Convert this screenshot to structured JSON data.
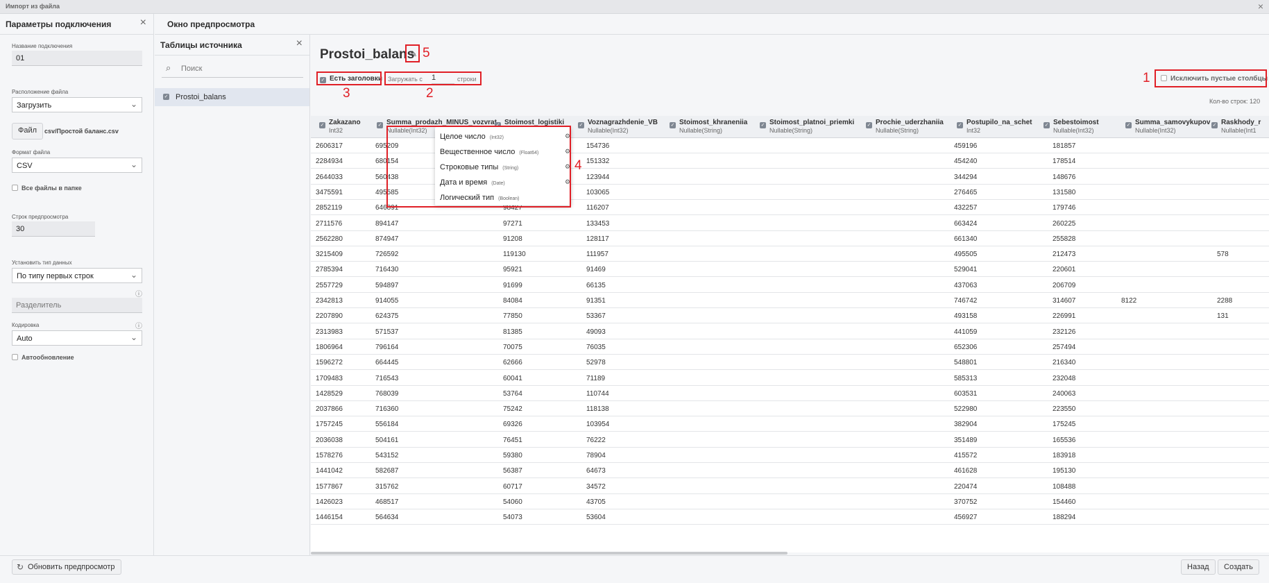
{
  "window": {
    "title": "Импорт из файла",
    "close": "×"
  },
  "left_panel": {
    "title": "Параметры подключения",
    "conn_name_label": "Название подключения",
    "conn_name_value": "01",
    "file_loc_label": "Расположение файла",
    "file_loc_value": "Загрузить",
    "file_button": "Файл",
    "file_name": "csv/Простой баланс.csv",
    "format_label": "Формат файла",
    "format_value": "CSV",
    "all_files_label": "Все файлы в папке",
    "preview_rows_label": "Строк предпросмотра",
    "preview_rows_value": "30",
    "dtype_label": "Установить тип данных",
    "dtype_value": "По типу первых строк",
    "delimiter_placeholder": "Разделитель",
    "encoding_label": "Кодировка",
    "encoding_value": "Auto",
    "autoupdate_label": "Автообновление"
  },
  "source_panel": {
    "title": "Таблицы источника",
    "search_placeholder": "Поиск",
    "tables": [
      "Prostoi_balans"
    ]
  },
  "preview": {
    "title": "Окно предпросмотра",
    "table_name": "Prostoi_balans",
    "has_headers_label": "Есть заголовки",
    "load_from_label": "Загружать с",
    "load_from_value": "1",
    "load_from_suffix": "строки",
    "exclude_empty_label": "Исключить пустые столбцы",
    "row_count": "Кол-во строк: 120"
  },
  "columns": [
    {
      "name": "Zakazano",
      "type": "Int32"
    },
    {
      "name": "Summa_prodazh_MINUS_vozvrat",
      "type": "Nullable(Int32)"
    },
    {
      "name": "Stoimost_logistiki",
      "type": "Int32"
    },
    {
      "name": "Voznagrazhdenie_VB",
      "type": "Nullable(Int32)"
    },
    {
      "name": "Stoimost_khraneniia",
      "type": "Nullable(String)"
    },
    {
      "name": "Stoimost_platnoi_priemki",
      "type": "Nullable(String)"
    },
    {
      "name": "Prochie_uderzhaniia",
      "type": "Nullable(String)"
    },
    {
      "name": "Postupilo_na_schet",
      "type": "Int32"
    },
    {
      "name": "Sebestoimost",
      "type": "Nullable(Int32)"
    },
    {
      "name": "Summa_samovykupov",
      "type": "Nullable(Int32)"
    },
    {
      "name": "Raskhody_r",
      "type": "Nullable(Int1"
    }
  ],
  "rows": [
    [
      "2606317",
      "695209",
      "",
      "154736",
      "",
      "",
      "",
      "459196",
      "181857",
      "",
      ""
    ],
    [
      "2284934",
      "680154",
      "",
      "151332",
      "",
      "",
      "",
      "454240",
      "178514",
      "",
      ""
    ],
    [
      "2644033",
      "560438",
      "",
      "123944",
      "",
      "",
      "",
      "344294",
      "148676",
      "",
      ""
    ],
    [
      "3475591",
      "495585",
      "",
      "103065",
      "",
      "",
      "",
      "276465",
      "131580",
      "",
      ""
    ],
    [
      "2852119",
      "646891",
      "98427",
      "116207",
      "",
      "",
      "",
      "432257",
      "179746",
      "",
      ""
    ],
    [
      "2711576",
      "894147",
      "97271",
      "133453",
      "",
      "",
      "",
      "663424",
      "260225",
      "",
      ""
    ],
    [
      "2562280",
      "874947",
      "91208",
      "128117",
      "",
      "",
      "",
      "661340",
      "255828",
      "",
      ""
    ],
    [
      "3215409",
      "726592",
      "119130",
      "111957",
      "",
      "",
      "",
      "495505",
      "212473",
      "",
      "578"
    ],
    [
      "2785394",
      "716430",
      "95921",
      "91469",
      "",
      "",
      "",
      "529041",
      "220601",
      "",
      ""
    ],
    [
      "2557729",
      "594897",
      "91699",
      "66135",
      "",
      "",
      "",
      "437063",
      "206709",
      "",
      ""
    ],
    [
      "2342813",
      "914055",
      "84084",
      "91351",
      "",
      "",
      "",
      "746742",
      "314607",
      "8122",
      "2288"
    ],
    [
      "2207890",
      "624375",
      "77850",
      "53367",
      "",
      "",
      "",
      "493158",
      "226991",
      "",
      "131"
    ],
    [
      "2313983",
      "571537",
      "81385",
      "49093",
      "",
      "",
      "",
      "441059",
      "232126",
      "",
      ""
    ],
    [
      "1806964",
      "796164",
      "70075",
      "76035",
      "",
      "",
      "",
      "652306",
      "257494",
      "",
      ""
    ],
    [
      "1596272",
      "664445",
      "62666",
      "52978",
      "",
      "",
      "",
      "548801",
      "216340",
      "",
      ""
    ],
    [
      "1709483",
      "716543",
      "60041",
      "71189",
      "",
      "",
      "",
      "585313",
      "232048",
      "",
      ""
    ],
    [
      "1428529",
      "768039",
      "53764",
      "110744",
      "",
      "",
      "",
      "603531",
      "240063",
      "",
      ""
    ],
    [
      "2037866",
      "716360",
      "75242",
      "118138",
      "",
      "",
      "",
      "522980",
      "223550",
      "",
      ""
    ],
    [
      "1757245",
      "556184",
      "69326",
      "103954",
      "",
      "",
      "",
      "382904",
      "175245",
      "",
      ""
    ],
    [
      "2036038",
      "504161",
      "76451",
      "76222",
      "",
      "",
      "",
      "351489",
      "165536",
      "",
      ""
    ],
    [
      "1578276",
      "543152",
      "59380",
      "78904",
      "",
      "",
      "",
      "415572",
      "183918",
      "",
      ""
    ],
    [
      "1441042",
      "582687",
      "56387",
      "64673",
      "",
      "",
      "",
      "461628",
      "195130",
      "",
      ""
    ],
    [
      "1577867",
      "315762",
      "60717",
      "34572",
      "",
      "",
      "",
      "220474",
      "108488",
      "",
      ""
    ],
    [
      "1426023",
      "468517",
      "54060",
      "43705",
      "",
      "",
      "",
      "370752",
      "154460",
      "",
      ""
    ],
    [
      "1446154",
      "564634",
      "54073",
      "53604",
      "",
      "",
      "",
      "456927",
      "188294",
      "",
      ""
    ]
  ],
  "type_menu": [
    {
      "label": "Целое число",
      "type": "(Int32)"
    },
    {
      "label": "Вещественное число",
      "type": "(Float64)"
    },
    {
      "label": "Строковые типы",
      "type": "(String)"
    },
    {
      "label": "Дата и время",
      "type": "(Date)"
    },
    {
      "label": "Логический тип",
      "type": "(Boolean)"
    }
  ],
  "annotations": [
    "1",
    "2",
    "3",
    "4",
    "5"
  ],
  "footer": {
    "refresh": "Обновить предпросмотр",
    "back": "Назад",
    "create": "Создать"
  },
  "icons": [
    "close-icon",
    "chevron-down-icon",
    "search-icon",
    "pencil-icon",
    "checkbox-icon",
    "info-icon",
    "refresh-icon",
    "settings-icon"
  ]
}
